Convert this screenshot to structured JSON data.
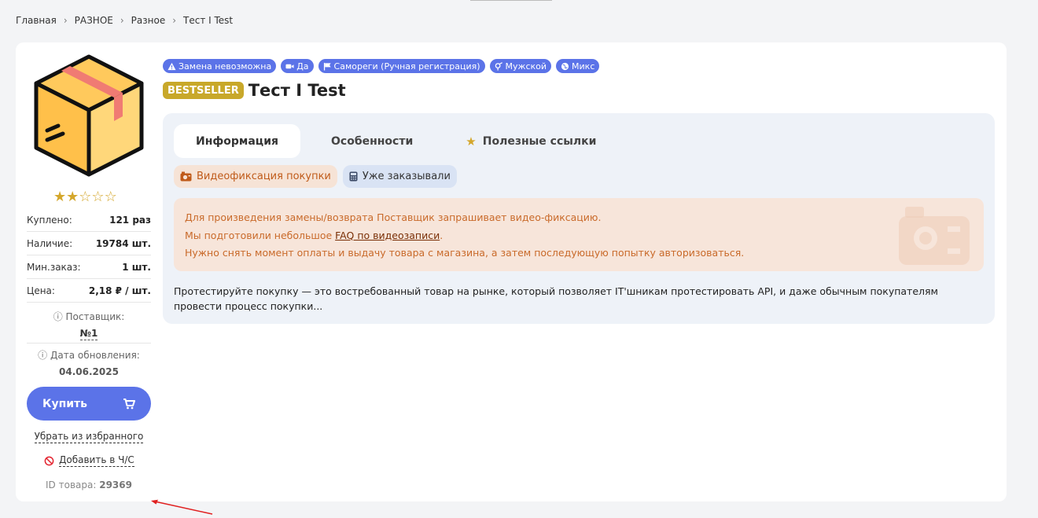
{
  "breadcrumb": [
    "Главная",
    "РАЗНОЕ",
    "Разное",
    "Тест I Test"
  ],
  "badges": [
    {
      "label": "Замена невозможна",
      "icon": "warning-icon"
    },
    {
      "label": "Да",
      "icon": "video-camera-icon"
    },
    {
      "label": "Самореги (Ручная регистрация)",
      "icon": "flag-icon"
    },
    {
      "label": "Мужской",
      "icon": "gender-icon"
    },
    {
      "label": "Микс",
      "icon": "globe-icon"
    }
  ],
  "product": {
    "bestseller": "BESTSELLER",
    "title": "Тест I Test",
    "rating": 2,
    "rating_max": 5
  },
  "stats": [
    {
      "key": "Куплено:",
      "value": "121 раз"
    },
    {
      "key": "Наличие:",
      "value": "19784 шт."
    },
    {
      "key": "Мин.заказ:",
      "value": "1 шт."
    },
    {
      "key": "Цена:",
      "value": "2,18 ₽ / шт."
    }
  ],
  "supplier": {
    "label": "Поставщик:",
    "value": "№1"
  },
  "updated": {
    "label": "Дата обновления:",
    "value": "04.06.2025"
  },
  "actions": {
    "buy": "Купить",
    "remove_favorite": "Убрать из избранного",
    "blacklist": "Добавить в Ч/С"
  },
  "product_id": {
    "label": "ID товара:",
    "value": "29369"
  },
  "tabs": [
    {
      "label": "Информация",
      "active": true
    },
    {
      "label": "Особенности",
      "active": false
    },
    {
      "label": "Полезные ссылки",
      "active": false
    }
  ],
  "chips": {
    "video": "Видеофиксация покупки",
    "ordered": "Уже заказывали"
  },
  "notice": {
    "line1": "Для произведения замены/возврата Поставщик запрашивает видео-фиксацию.",
    "line2_prefix": "Мы подготовили небольшое ",
    "line2_link": "FAQ по видеозаписи",
    "line2_suffix": ".",
    "line3": "Нужно снять момент оплаты и выдачу товара с магазина, а затем последующую попытку авторизоваться."
  },
  "description": "Протестируйте покупку — это востребованный товар на рынке, который позволяет IT'шникам протестировать API, и даже обычным покупателям провести процесс покупки...",
  "colors": {
    "accent": "#5b73e8",
    "bestseller": "#c8a82a",
    "star": "#d4a72c",
    "notice_bg": "#f7e5da",
    "notice_text": "#c96a2a",
    "annotation_arrow": "#e02020"
  }
}
